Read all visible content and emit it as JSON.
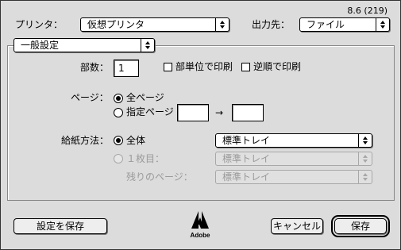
{
  "version": "8.6 (219)",
  "printer": {
    "label": "プリンタ：",
    "value": "仮想プリンタ"
  },
  "destination": {
    "label": "出力先：",
    "value": "ファイル"
  },
  "panel": {
    "value": "一般設定"
  },
  "copies": {
    "label": "部数：",
    "value": "1"
  },
  "collate": {
    "label": "部単位で印刷",
    "checked": false
  },
  "reverse": {
    "label": "逆順で印刷",
    "checked": false
  },
  "pages": {
    "label": "ページ：",
    "all_label": "全ページ",
    "range_label": "指定ページ",
    "from": "",
    "arrow": "→",
    "to": "",
    "selected": "all"
  },
  "paper_source": {
    "label": "給紙方法：",
    "all_label": "全体",
    "all_value": "標準トレイ",
    "first_label": "１枚目：",
    "first_value": "標準トレイ",
    "rest_label": "残りのページ：",
    "rest_value": "標準トレイ",
    "selected": "all"
  },
  "buttons": {
    "save_settings": "設定を保存",
    "cancel": "キャンセル",
    "save": "保存"
  },
  "logo": {
    "text": "Adobe",
    "icon": "adobe-logo-icon"
  }
}
